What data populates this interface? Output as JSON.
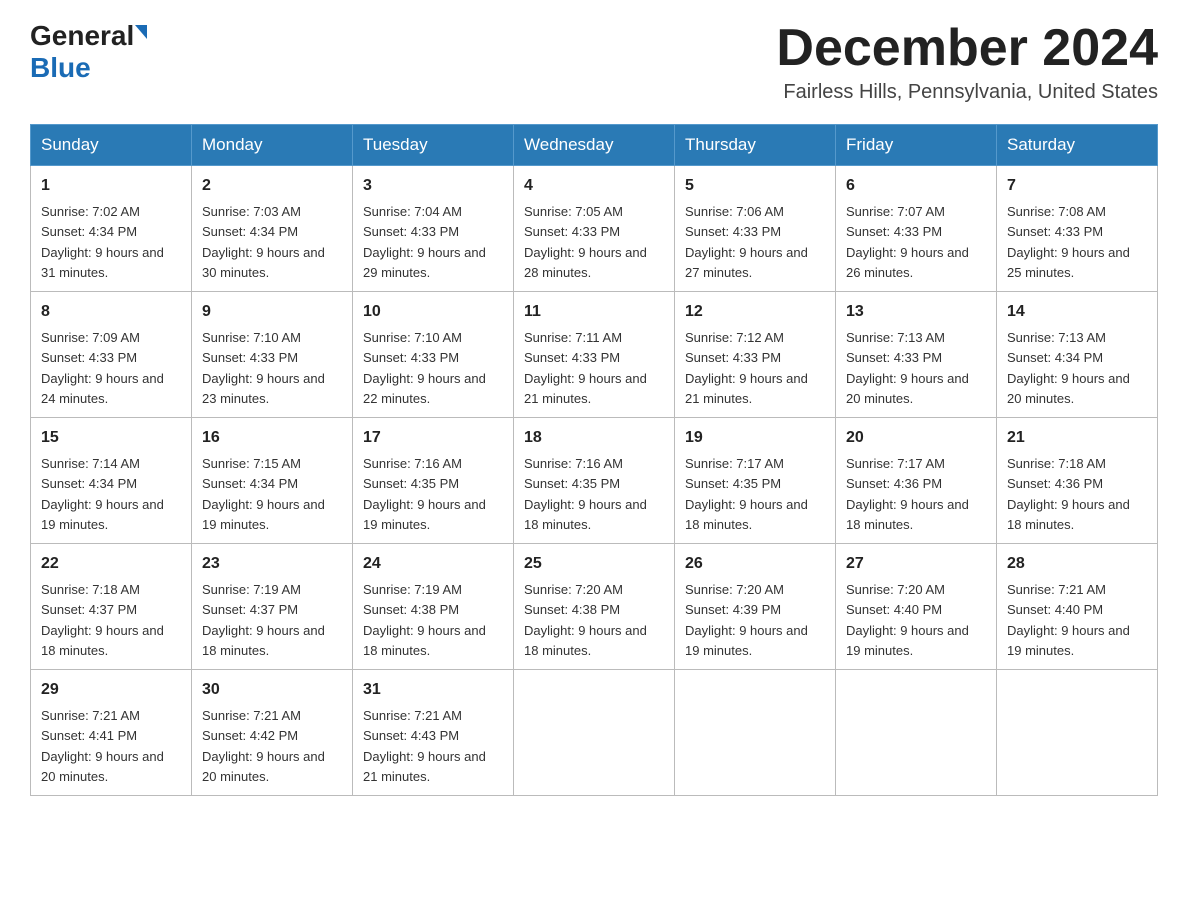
{
  "header": {
    "logo_general": "General",
    "logo_blue": "Blue",
    "month_title": "December 2024",
    "location": "Fairless Hills, Pennsylvania, United States"
  },
  "days_of_week": [
    "Sunday",
    "Monday",
    "Tuesday",
    "Wednesday",
    "Thursday",
    "Friday",
    "Saturday"
  ],
  "weeks": [
    [
      {
        "day": "1",
        "sunrise": "7:02 AM",
        "sunset": "4:34 PM",
        "daylight": "9 hours and 31 minutes."
      },
      {
        "day": "2",
        "sunrise": "7:03 AM",
        "sunset": "4:34 PM",
        "daylight": "9 hours and 30 minutes."
      },
      {
        "day": "3",
        "sunrise": "7:04 AM",
        "sunset": "4:33 PM",
        "daylight": "9 hours and 29 minutes."
      },
      {
        "day": "4",
        "sunrise": "7:05 AM",
        "sunset": "4:33 PM",
        "daylight": "9 hours and 28 minutes."
      },
      {
        "day": "5",
        "sunrise": "7:06 AM",
        "sunset": "4:33 PM",
        "daylight": "9 hours and 27 minutes."
      },
      {
        "day": "6",
        "sunrise": "7:07 AM",
        "sunset": "4:33 PM",
        "daylight": "9 hours and 26 minutes."
      },
      {
        "day": "7",
        "sunrise": "7:08 AM",
        "sunset": "4:33 PM",
        "daylight": "9 hours and 25 minutes."
      }
    ],
    [
      {
        "day": "8",
        "sunrise": "7:09 AM",
        "sunset": "4:33 PM",
        "daylight": "9 hours and 24 minutes."
      },
      {
        "day": "9",
        "sunrise": "7:10 AM",
        "sunset": "4:33 PM",
        "daylight": "9 hours and 23 minutes."
      },
      {
        "day": "10",
        "sunrise": "7:10 AM",
        "sunset": "4:33 PM",
        "daylight": "9 hours and 22 minutes."
      },
      {
        "day": "11",
        "sunrise": "7:11 AM",
        "sunset": "4:33 PM",
        "daylight": "9 hours and 21 minutes."
      },
      {
        "day": "12",
        "sunrise": "7:12 AM",
        "sunset": "4:33 PM",
        "daylight": "9 hours and 21 minutes."
      },
      {
        "day": "13",
        "sunrise": "7:13 AM",
        "sunset": "4:33 PM",
        "daylight": "9 hours and 20 minutes."
      },
      {
        "day": "14",
        "sunrise": "7:13 AM",
        "sunset": "4:34 PM",
        "daylight": "9 hours and 20 minutes."
      }
    ],
    [
      {
        "day": "15",
        "sunrise": "7:14 AM",
        "sunset": "4:34 PM",
        "daylight": "9 hours and 19 minutes."
      },
      {
        "day": "16",
        "sunrise": "7:15 AM",
        "sunset": "4:34 PM",
        "daylight": "9 hours and 19 minutes."
      },
      {
        "day": "17",
        "sunrise": "7:16 AM",
        "sunset": "4:35 PM",
        "daylight": "9 hours and 19 minutes."
      },
      {
        "day": "18",
        "sunrise": "7:16 AM",
        "sunset": "4:35 PM",
        "daylight": "9 hours and 18 minutes."
      },
      {
        "day": "19",
        "sunrise": "7:17 AM",
        "sunset": "4:35 PM",
        "daylight": "9 hours and 18 minutes."
      },
      {
        "day": "20",
        "sunrise": "7:17 AM",
        "sunset": "4:36 PM",
        "daylight": "9 hours and 18 minutes."
      },
      {
        "day": "21",
        "sunrise": "7:18 AM",
        "sunset": "4:36 PM",
        "daylight": "9 hours and 18 minutes."
      }
    ],
    [
      {
        "day": "22",
        "sunrise": "7:18 AM",
        "sunset": "4:37 PM",
        "daylight": "9 hours and 18 minutes."
      },
      {
        "day": "23",
        "sunrise": "7:19 AM",
        "sunset": "4:37 PM",
        "daylight": "9 hours and 18 minutes."
      },
      {
        "day": "24",
        "sunrise": "7:19 AM",
        "sunset": "4:38 PM",
        "daylight": "9 hours and 18 minutes."
      },
      {
        "day": "25",
        "sunrise": "7:20 AM",
        "sunset": "4:38 PM",
        "daylight": "9 hours and 18 minutes."
      },
      {
        "day": "26",
        "sunrise": "7:20 AM",
        "sunset": "4:39 PM",
        "daylight": "9 hours and 19 minutes."
      },
      {
        "day": "27",
        "sunrise": "7:20 AM",
        "sunset": "4:40 PM",
        "daylight": "9 hours and 19 minutes."
      },
      {
        "day": "28",
        "sunrise": "7:21 AM",
        "sunset": "4:40 PM",
        "daylight": "9 hours and 19 minutes."
      }
    ],
    [
      {
        "day": "29",
        "sunrise": "7:21 AM",
        "sunset": "4:41 PM",
        "daylight": "9 hours and 20 minutes."
      },
      {
        "day": "30",
        "sunrise": "7:21 AM",
        "sunset": "4:42 PM",
        "daylight": "9 hours and 20 minutes."
      },
      {
        "day": "31",
        "sunrise": "7:21 AM",
        "sunset": "4:43 PM",
        "daylight": "9 hours and 21 minutes."
      },
      null,
      null,
      null,
      null
    ]
  ],
  "labels": {
    "sunrise_prefix": "Sunrise: ",
    "sunset_prefix": "Sunset: ",
    "daylight_prefix": "Daylight: "
  }
}
